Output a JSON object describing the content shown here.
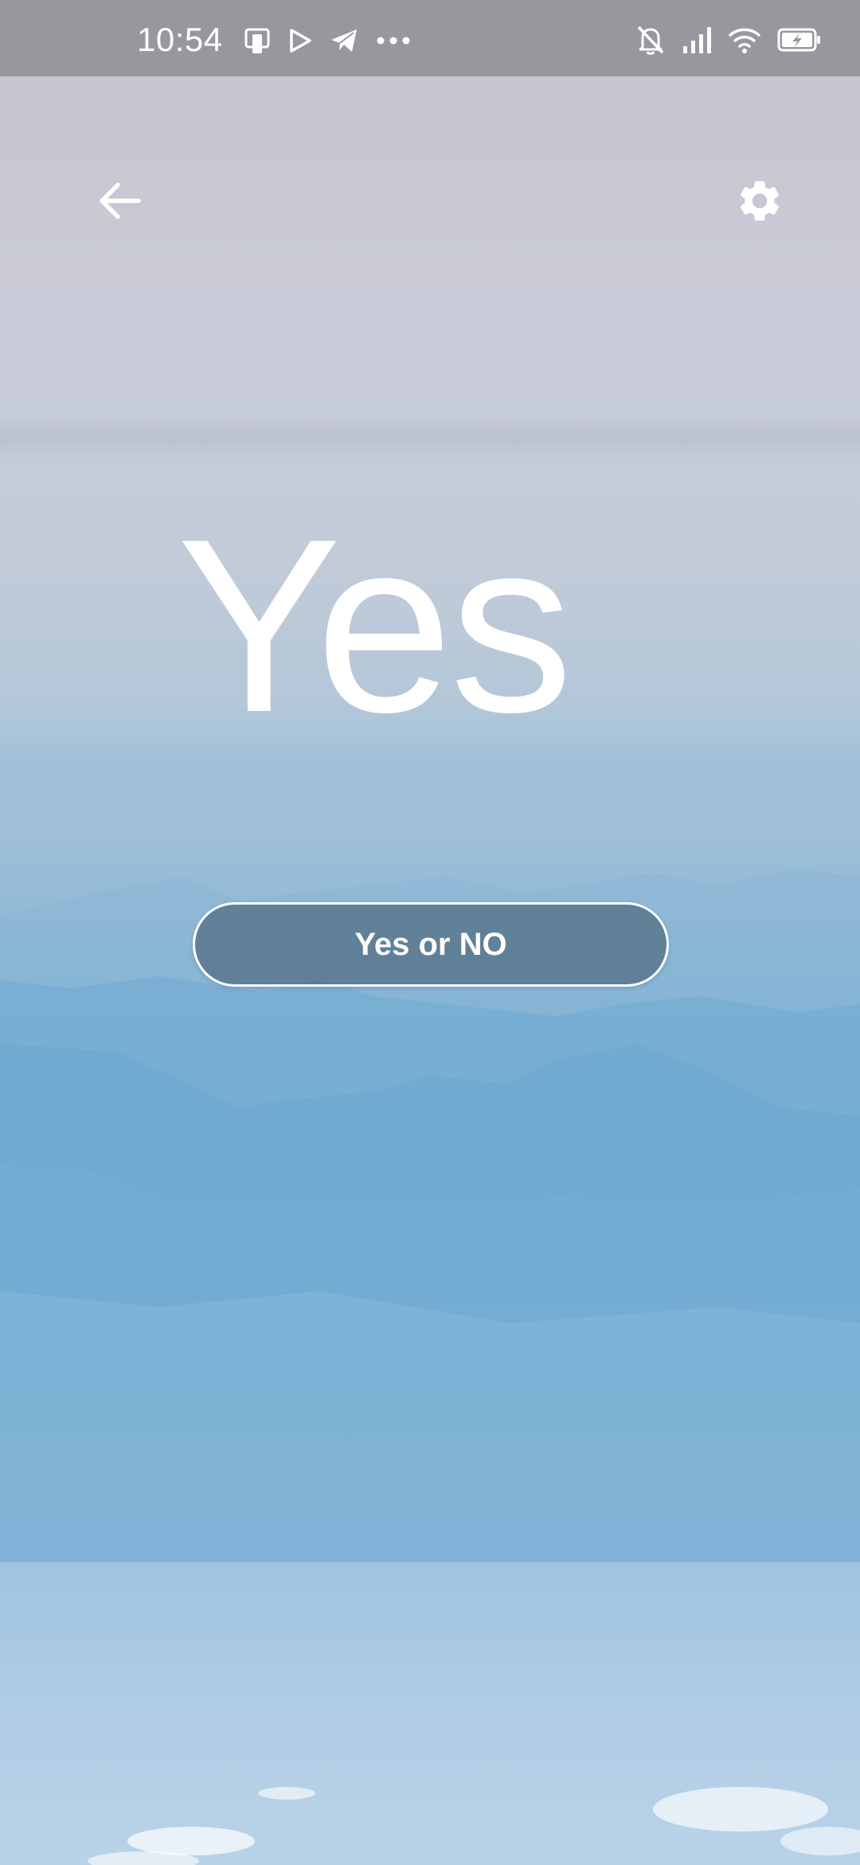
{
  "status_bar": {
    "time": "10:54",
    "left_icons": [
      "sim-card-icon",
      "play-store-icon",
      "telegram-icon",
      "more-notifications-icon"
    ],
    "right_icons": [
      "bell-off-icon",
      "signal-icon",
      "wifi-icon",
      "battery-charging-icon"
    ]
  },
  "toolbar": {
    "back_icon": "arrow-left-icon",
    "settings_icon": "gear-icon"
  },
  "main": {
    "answer": "Yes",
    "button_label": "Yes or NO"
  },
  "colors": {
    "status_bar_bg": "#98979e",
    "text": "#ffffff",
    "button_fill": "#465f73",
    "sky_top": "#c3c3cf",
    "sky_bottom": "#b9d2e8"
  }
}
